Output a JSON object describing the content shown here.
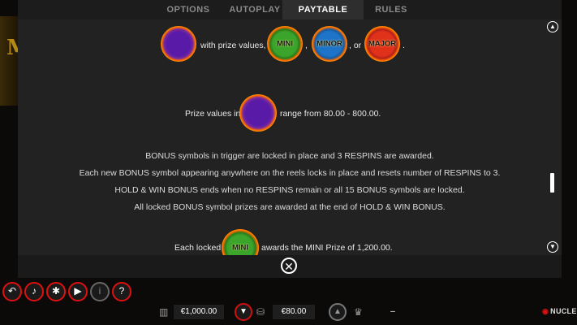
{
  "tabs": [
    {
      "label": "OPTIONS",
      "active": false
    },
    {
      "label": "AUTOPLAY",
      "active": false
    },
    {
      "label": "PAYTABLE",
      "active": true
    },
    {
      "label": "RULES",
      "active": false
    }
  ],
  "paytable": {
    "line1_text": "with prize values,",
    "line1_sep1": ",",
    "line1_or": ", or",
    "line1_end": ".",
    "orbs": {
      "mini": "MINI",
      "minor": "MINOR",
      "major": "MAJOR"
    },
    "line2_pre": "Prize values in",
    "line2_post": "range from 80.00 - 800.00.",
    "rules": [
      "BONUS symbols in trigger are locked in place and 3 RESPINS are awarded.",
      "Each new BONUS symbol appearing anywhere on the reels locks in place and resets number of RESPINS to 3.",
      "HOLD & WIN BONUS ends when no RESPINS remain or all 15 BONUS symbols are locked.",
      "All locked BONUS symbol prizes are awarded at the end of HOLD & WIN BONUS."
    ],
    "last_pre": "Each locked",
    "last_post": "awards the MINI Prize of 1,200.00."
  },
  "bottom": {
    "balance": "€1,000.00",
    "bet": "€80.00",
    "win": "–",
    "brand": "NUCLEUS"
  },
  "colors": {
    "accent": "#e01010",
    "panel": "#222222",
    "mini": "#3aa52a",
    "minor": "#1e74c9",
    "major": "#e0321a",
    "bonus": "#5a1aa8"
  },
  "icons": [
    "scroll-up-icon",
    "scroll-down-icon",
    "close-icon",
    "back-icon",
    "sound-icon",
    "settings-icon",
    "play-icon",
    "info-icon",
    "help-icon",
    "bank-icon",
    "coins-icon",
    "trophy-icon"
  ]
}
